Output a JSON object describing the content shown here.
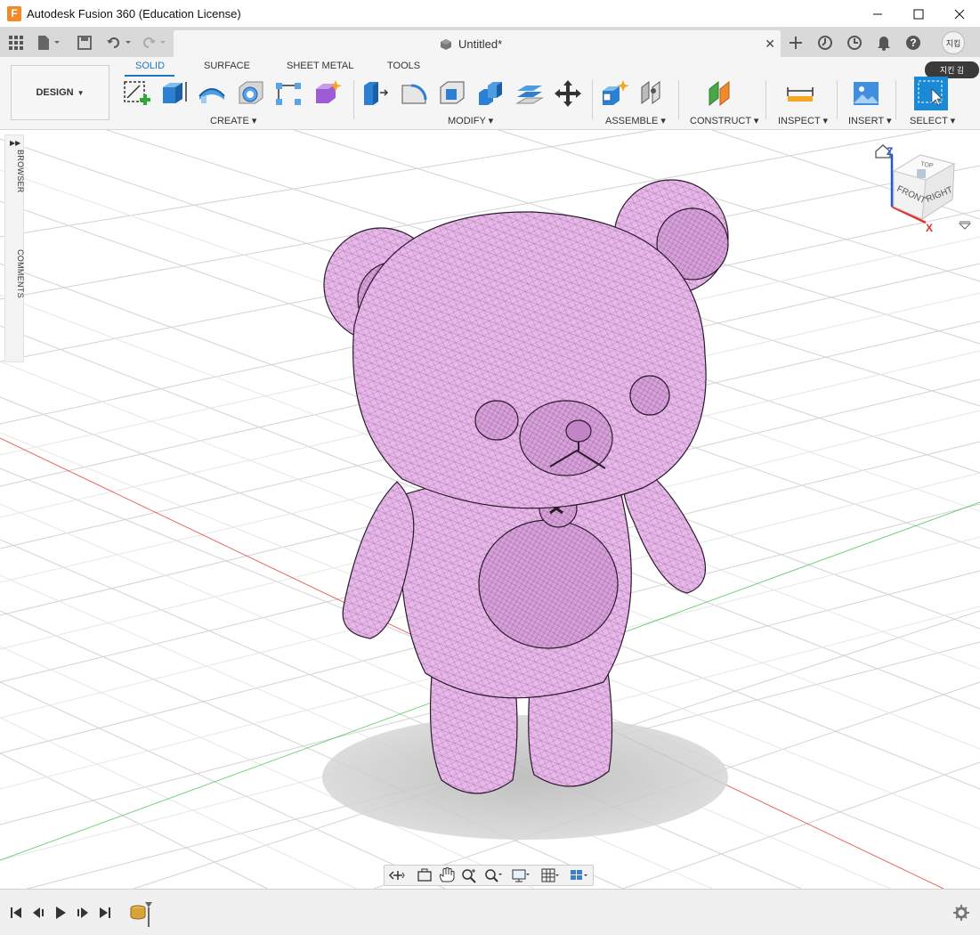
{
  "window": {
    "title": "Autodesk Fusion 360 (Education License)",
    "app_icon_letter": "F",
    "minimize_icon": "minimize-icon",
    "maximize_icon": "maximize-icon",
    "close_icon": "close-icon"
  },
  "tabbar": {
    "document_tab": "Untitled*",
    "user_initials": "지킴",
    "user_tooltip": "지킨 김"
  },
  "toolbar": {
    "workspace": "DESIGN",
    "tabs": [
      "SOLID",
      "SURFACE",
      "SHEET METAL",
      "TOOLS"
    ],
    "active_tab": "SOLID",
    "groups": {
      "create": "CREATE",
      "modify": "MODIFY",
      "assemble": "ASSEMBLE",
      "construct": "CONSTRUCT",
      "inspect": "INSPECT",
      "insert": "INSERT",
      "select": "SELECT"
    }
  },
  "side_panel": {
    "browser": "BROWSER",
    "comments": "COMMENTS"
  },
  "viewcube": {
    "front": "FRONT",
    "right": "RIGHT",
    "top": "TOP",
    "x_axis": "X",
    "z_axis": "Z"
  },
  "colors": {
    "accent": "#1a78c2",
    "model_fill": "#e9b7ea",
    "x_axis": "#e0312c",
    "y_axis": "#49c04a",
    "z_axis": "#2456d6"
  }
}
